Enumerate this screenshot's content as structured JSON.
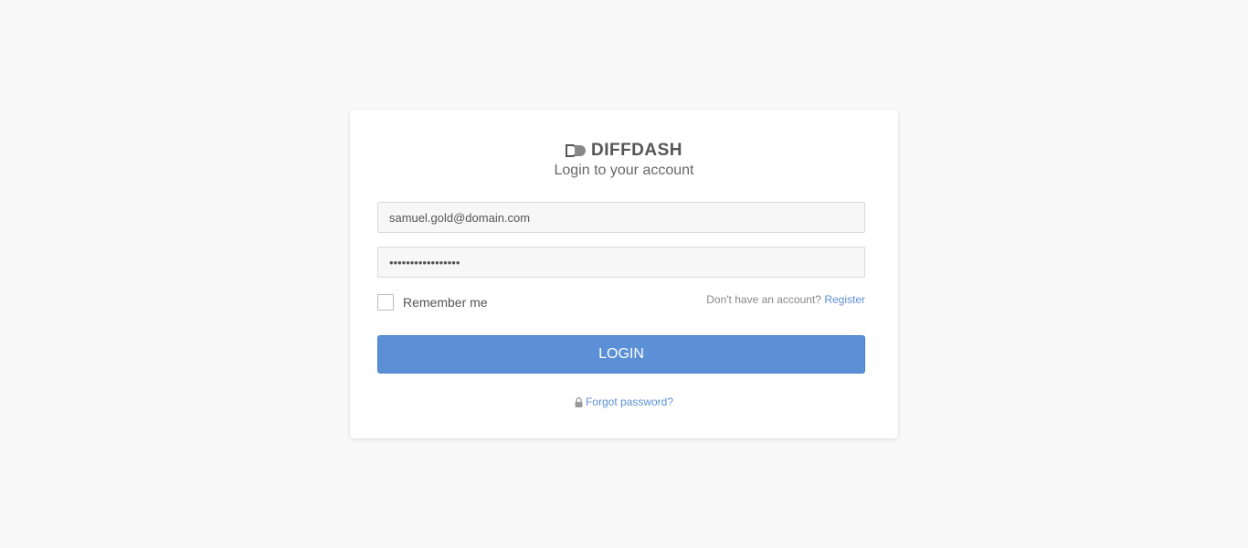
{
  "brand": {
    "name": "DIFFDASH",
    "logo_icon": "diffdash-logo-icon"
  },
  "subtitle": "Login to your account",
  "form": {
    "email_value": "samuel.gold@domain.com",
    "password_value": "•••••••••••••••••",
    "remember_label": "Remember me",
    "register_prompt": "Don't have an account?",
    "register_link": "Register",
    "login_button": "LOGIN",
    "forgot_icon": "lock-icon",
    "forgot_link": "Forgot password?"
  },
  "colors": {
    "accent": "#5b8fd6",
    "background": "#f9f9f9",
    "card": "#ffffff"
  }
}
